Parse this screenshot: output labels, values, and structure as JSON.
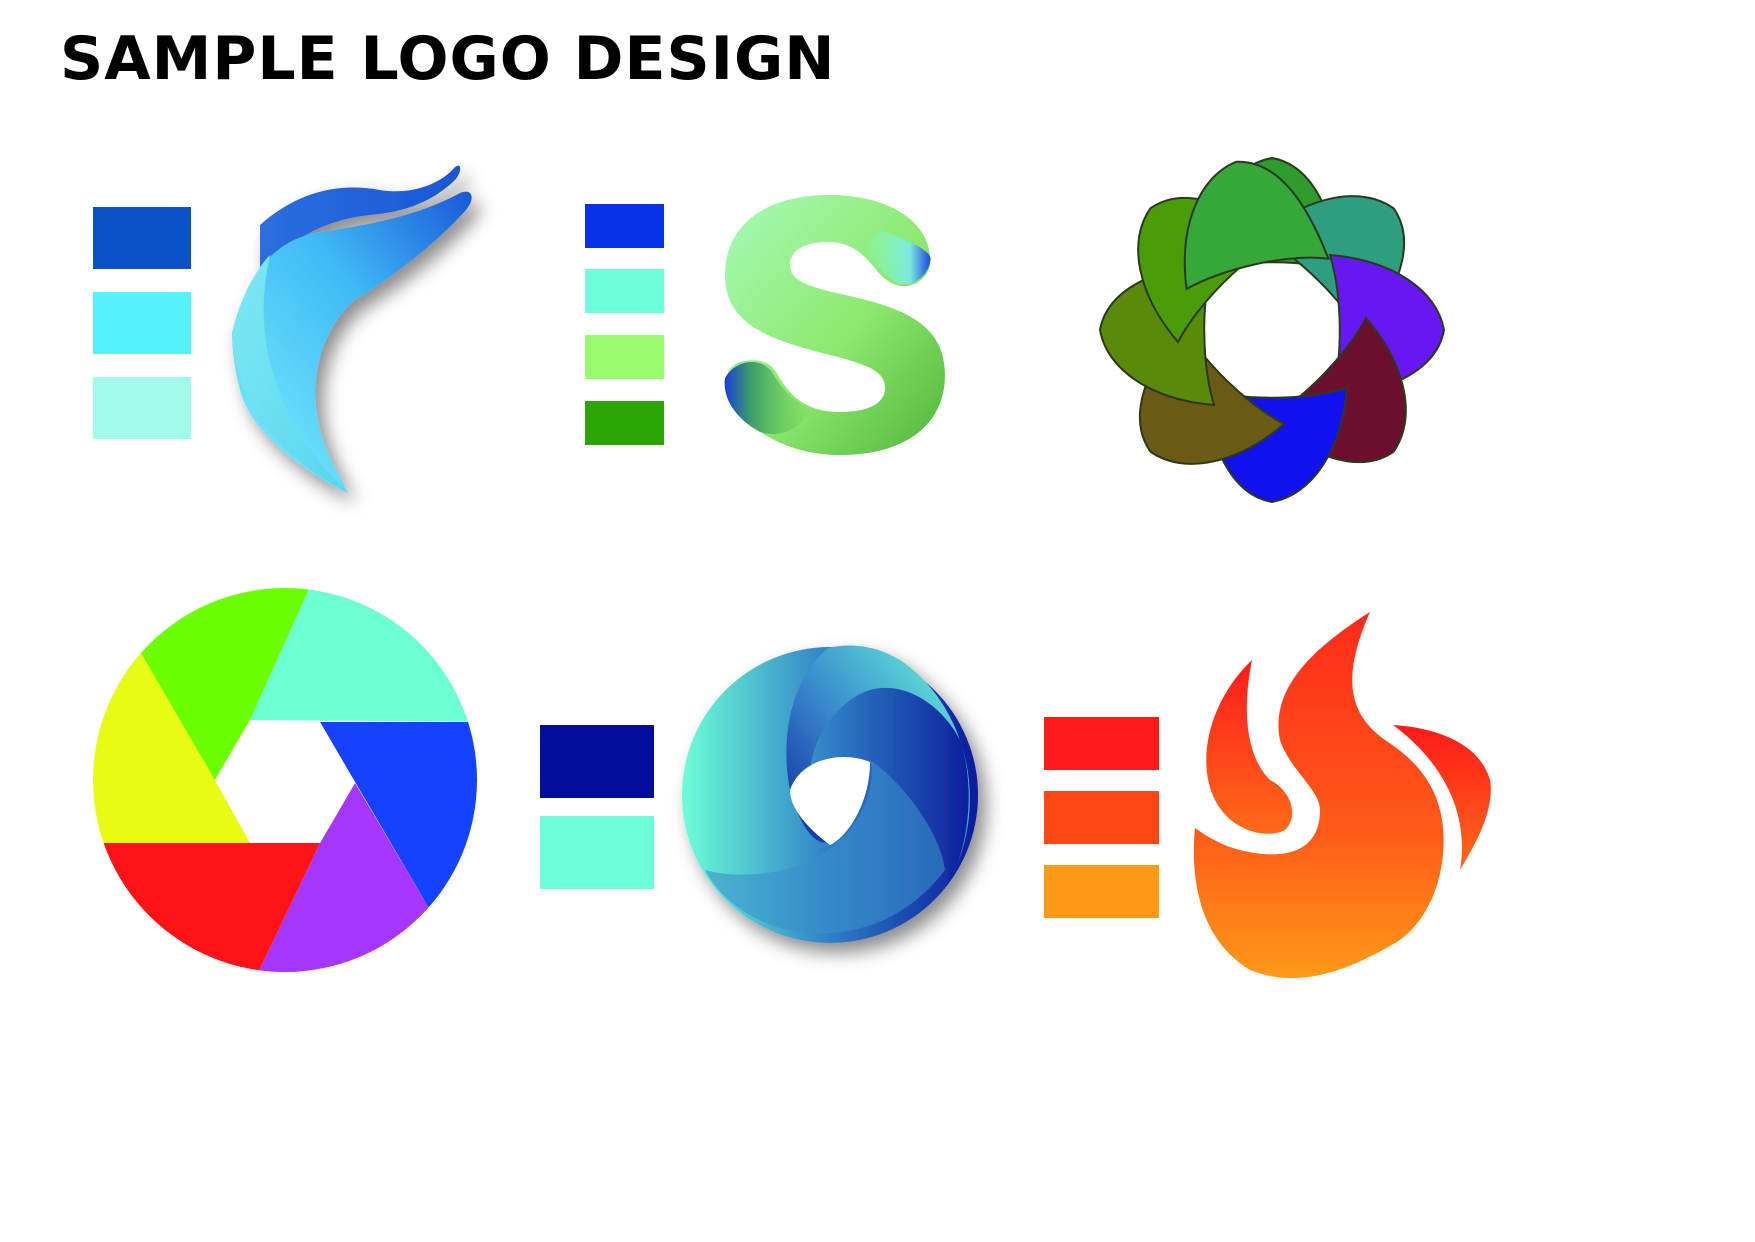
{
  "page": {
    "title": "SAMPLE LOGO DESIGN"
  },
  "logos": [
    {
      "name": "wing-f-logo",
      "palette": [
        "#0b52c8",
        "#55f2fb",
        "#a1fbea"
      ]
    },
    {
      "name": "s-letter-logo",
      "palette": [
        "#0832e8",
        "#6cffd9",
        "#98fd6c",
        "#2aa502"
      ]
    },
    {
      "name": "petal-ring-logo",
      "palette": [
        "#2e9c2c",
        "#2f9e80",
        "#6718f2",
        "#6c0f2e",
        "#1212f0",
        "#6b5a14",
        "#5a8a0a",
        "#4a9c08"
      ]
    },
    {
      "name": "aperture-logo",
      "palette": [
        "#6cff01",
        "#6cffd1",
        "#1442ff",
        "#a535ff",
        "#ff1316",
        "#e8fb13"
      ]
    },
    {
      "name": "swirl-orb-logo",
      "palette": [
        "#010c9b",
        "#6cffd8"
      ]
    },
    {
      "name": "flame-logo",
      "palette": [
        "#ff1a1a",
        "#ff4614",
        "#ff9a18"
      ]
    }
  ]
}
